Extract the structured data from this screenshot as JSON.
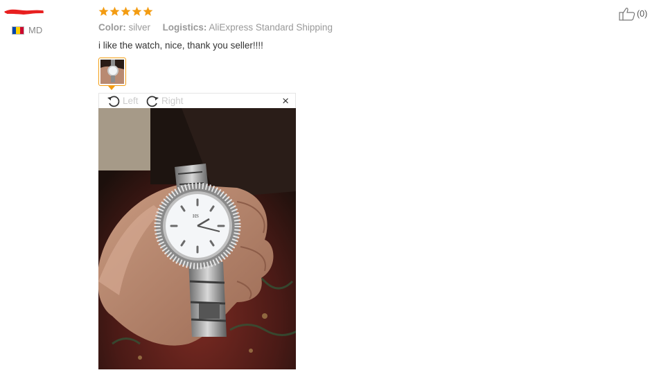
{
  "reviewer": {
    "name_redacted": true,
    "country_code": "MD"
  },
  "rating": {
    "stars": 5,
    "max": 5,
    "color": "#f39c12"
  },
  "attributes": {
    "color_label": "Color:",
    "color_value": "silver",
    "logistics_label": "Logistics:",
    "logistics_value": "AliExpress Standard Shipping"
  },
  "comment": "i like the watch, nice, thank you seller!!!!",
  "viewer": {
    "rotate_left_label": "Left",
    "rotate_right_label": "Right",
    "close_symbol": "×"
  },
  "helpful": {
    "count_text": "(0)",
    "icon": "thumbs-up-icon"
  },
  "colors": {
    "accent": "#f39c12",
    "text": "#333333",
    "muted": "#999999"
  }
}
